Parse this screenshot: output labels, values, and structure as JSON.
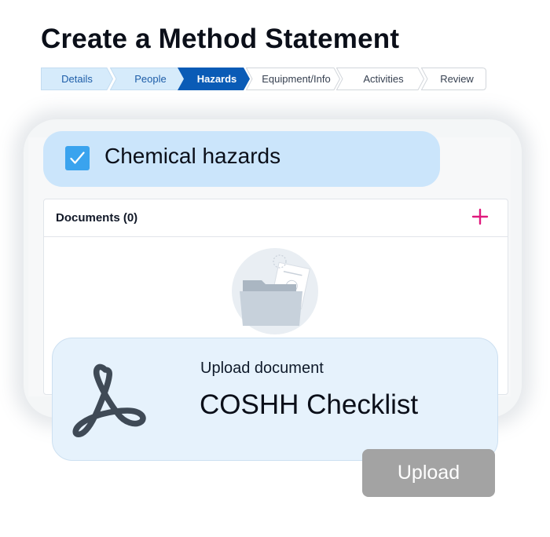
{
  "page": {
    "title": "Create a Method Statement"
  },
  "stepper": {
    "steps": [
      {
        "label": "Details",
        "state": "completed"
      },
      {
        "label": "People",
        "state": "completed"
      },
      {
        "label": "Hazards",
        "state": "active"
      },
      {
        "label": "Equipment/Info",
        "state": "upcoming"
      },
      {
        "label": "Activities",
        "state": "upcoming"
      },
      {
        "label": "Review",
        "state": "upcoming"
      }
    ]
  },
  "hazard": {
    "label": "Chemical hazards",
    "checked": true
  },
  "documents": {
    "title": "Documents (0)",
    "add_icon": "plus-icon"
  },
  "upload_card": {
    "caption": "Upload document",
    "document_name": "COSHH Checklist",
    "icon": "pdf-icon"
  },
  "upload_button": {
    "label": "Upload"
  },
  "colors": {
    "active_step": "#0a5bb6",
    "completed_step": "#d6ebfb",
    "checkbox": "#3aa3ee",
    "hazard_pill": "#cbe5fb",
    "upload_card": "#e6f2fc",
    "plus": "#e0197d",
    "upload_button": "#a3a3a3"
  }
}
